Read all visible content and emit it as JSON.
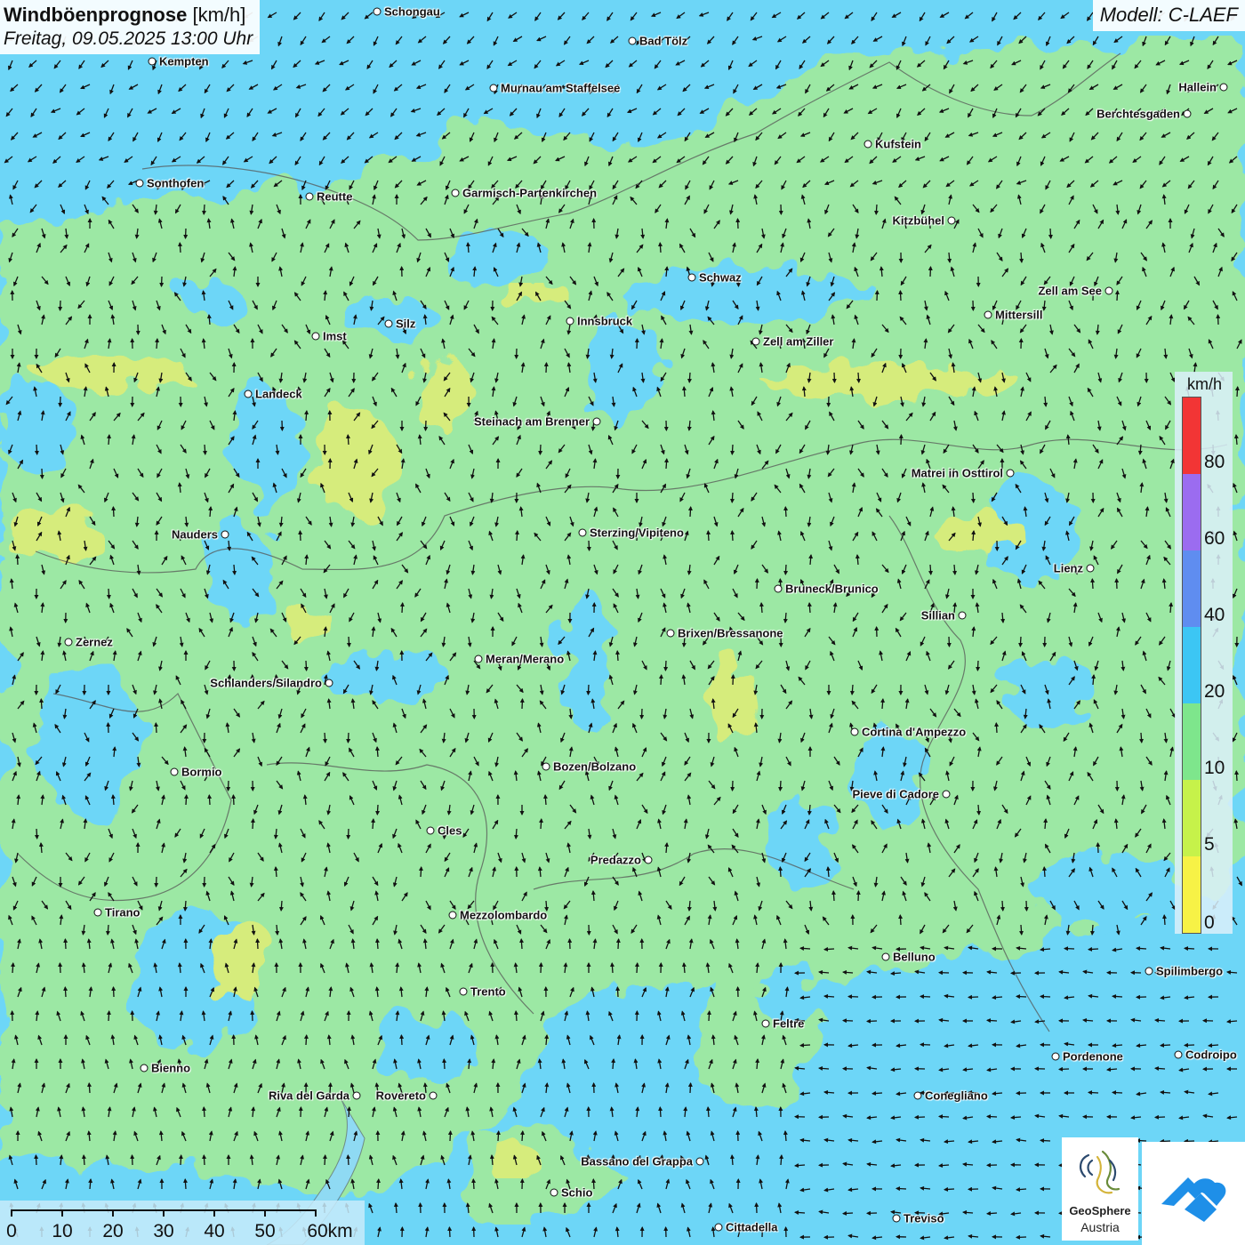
{
  "header": {
    "title": "Windböenprognose",
    "unit": "[km/h]",
    "datetime": "Freitag, 09.05.2025 13:00 Uhr",
    "model": "Modell: C-LAEF"
  },
  "legend": {
    "unit": "km/h",
    "ticks": [
      "80",
      "60",
      "40",
      "20",
      "10",
      "5",
      "0"
    ],
    "colors": [
      "#f23535",
      "#9b6cf0",
      "#5f8df0",
      "#3cc6f4",
      "#7ee68c",
      "#c6f24a",
      "#f7f246"
    ]
  },
  "palette": {
    "calm_blue": "#6dd6f7",
    "moderate_green": "#9ce8a4",
    "strong_yellow": "#d6ec7c",
    "arrow_color": "#111111"
  },
  "cities": [
    {
      "name": "Schongau",
      "label": "Schongau",
      "side": "right"
    },
    {
      "name": "Bad Tölz",
      "label": "Bad Tölz",
      "side": "right"
    },
    {
      "name": "Kempten",
      "label": "Kempten",
      "side": "right"
    },
    {
      "name": "Murnau am Staffelsee",
      "label": "Murnau am Staffelsee",
      "side": "right"
    },
    {
      "name": "Hallein",
      "label": "Hallein",
      "side": "left"
    },
    {
      "name": "Berchtesgaden",
      "label": "Berchtesgaden",
      "side": "left"
    },
    {
      "name": "Kufstein",
      "label": "Kufstein",
      "side": "right"
    },
    {
      "name": "Sonthofen",
      "label": "Sonthofen",
      "side": "right"
    },
    {
      "name": "Reutte",
      "label": "Reutte",
      "side": "right"
    },
    {
      "name": "Garmisch-Partenkirchen",
      "label": "Garmisch-Partenkirchen",
      "side": "right"
    },
    {
      "name": "Kitzbühel",
      "label": "Kitzbühel",
      "side": "left"
    },
    {
      "name": "Schwaz",
      "label": "Schwaz",
      "side": "right"
    },
    {
      "name": "Zell am See",
      "label": "Zell am See",
      "side": "left"
    },
    {
      "name": "Mittersill",
      "label": "Mittersill",
      "side": "right"
    },
    {
      "name": "Innsbruck",
      "label": "Innsbruck",
      "side": "right"
    },
    {
      "name": "Silz",
      "label": "Silz",
      "side": "right"
    },
    {
      "name": "Imst",
      "label": "Imst",
      "side": "right"
    },
    {
      "name": "Zell am Ziller",
      "label": "Zell am Ziller",
      "side": "right"
    },
    {
      "name": "Landeck",
      "label": "Landeck",
      "side": "right"
    },
    {
      "name": "Steinach am Brenner",
      "label": "Steinach am Brenner",
      "side": "left"
    },
    {
      "name": "Matrei in Osttirol",
      "label": "Matrei in Osttirol",
      "side": "left"
    },
    {
      "name": "Nauders",
      "label": "Nauders",
      "side": "left"
    },
    {
      "name": "Sterzing/Vipiteno",
      "label": "Sterzing/Vipiteno",
      "side": "right"
    },
    {
      "name": "Lienz",
      "label": "Lienz",
      "side": "left"
    },
    {
      "name": "Bruneck/Brunico",
      "label": "Bruneck/Brunico",
      "side": "right"
    },
    {
      "name": "Sillian",
      "label": "Sillian",
      "side": "left"
    },
    {
      "name": "Brixen/Bressanone",
      "label": "Brixen/Bressanone",
      "side": "right"
    },
    {
      "name": "Zernez",
      "label": "Zernez",
      "side": "right"
    },
    {
      "name": "Meran/Merano",
      "label": "Meran/Merano",
      "side": "right"
    },
    {
      "name": "Schlanders/Silandro",
      "label": "Schlanders/Silandro",
      "side": "left"
    },
    {
      "name": "Cortina d'Ampezzo",
      "label": "Cortina d'Ampezzo",
      "side": "right"
    },
    {
      "name": "Bozen/Bolzano",
      "label": "Bozen/Bolzano",
      "side": "right"
    },
    {
      "name": "Bormio",
      "label": "Bormio",
      "side": "right"
    },
    {
      "name": "Pieve di Cadore",
      "label": "Pieve di Cadore",
      "side": "left"
    },
    {
      "name": "Cles",
      "label": "Cles",
      "side": "right"
    },
    {
      "name": "Predazzo",
      "label": "Predazzo",
      "side": "left"
    },
    {
      "name": "Tirano",
      "label": "Tirano",
      "side": "right"
    },
    {
      "name": "Mezzolombardo",
      "label": "Mezzolombardo",
      "side": "right"
    },
    {
      "name": "Belluno",
      "label": "Belluno",
      "side": "right"
    },
    {
      "name": "Spilimbergo",
      "label": "Spilimbergo",
      "side": "right"
    },
    {
      "name": "Trento",
      "label": "Trento",
      "side": "right"
    },
    {
      "name": "Feltre",
      "label": "Feltre",
      "side": "right"
    },
    {
      "name": "Pordenone",
      "label": "Pordenone",
      "side": "right"
    },
    {
      "name": "Codroipo",
      "label": "Codroipo",
      "side": "right"
    },
    {
      "name": "Bienno",
      "label": "Bienno",
      "side": "right"
    },
    {
      "name": "Riva del Garda",
      "label": "Riva del Garda",
      "side": "left"
    },
    {
      "name": "Rovereto",
      "label": "Rovereto",
      "side": "left"
    },
    {
      "name": "Conegliano",
      "label": "Conegliano",
      "side": "right"
    },
    {
      "name": "Bassano del Grappa",
      "label": "Bassano del Grappa",
      "side": "left"
    },
    {
      "name": "Schio",
      "label": "Schio",
      "side": "right"
    },
    {
      "name": "Treviso",
      "label": "Treviso",
      "side": "right"
    },
    {
      "name": "Cittadella",
      "label": "Cittadella",
      "side": "right"
    }
  ],
  "scalebar": {
    "labels": [
      "0",
      "10",
      "20",
      "30",
      "40",
      "50",
      "60km"
    ]
  },
  "logos": {
    "geosphere_line1": "GeoSphere",
    "geosphere_line2": "Austria"
  }
}
